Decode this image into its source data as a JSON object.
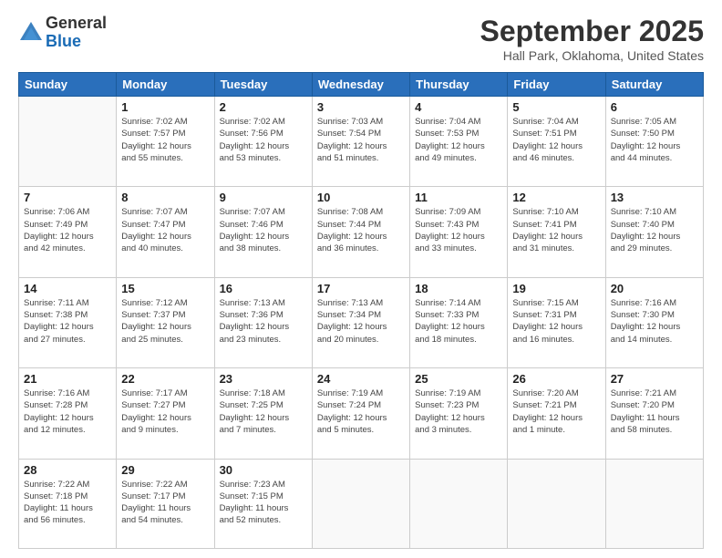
{
  "header": {
    "logo": {
      "general": "General",
      "blue": "Blue"
    },
    "title": "September 2025",
    "location": "Hall Park, Oklahoma, United States"
  },
  "weekdays": [
    "Sunday",
    "Monday",
    "Tuesday",
    "Wednesday",
    "Thursday",
    "Friday",
    "Saturday"
  ],
  "weeks": [
    [
      {
        "day": "",
        "info": ""
      },
      {
        "day": "1",
        "info": "Sunrise: 7:02 AM\nSunset: 7:57 PM\nDaylight: 12 hours\nand 55 minutes."
      },
      {
        "day": "2",
        "info": "Sunrise: 7:02 AM\nSunset: 7:56 PM\nDaylight: 12 hours\nand 53 minutes."
      },
      {
        "day": "3",
        "info": "Sunrise: 7:03 AM\nSunset: 7:54 PM\nDaylight: 12 hours\nand 51 minutes."
      },
      {
        "day": "4",
        "info": "Sunrise: 7:04 AM\nSunset: 7:53 PM\nDaylight: 12 hours\nand 49 minutes."
      },
      {
        "day": "5",
        "info": "Sunrise: 7:04 AM\nSunset: 7:51 PM\nDaylight: 12 hours\nand 46 minutes."
      },
      {
        "day": "6",
        "info": "Sunrise: 7:05 AM\nSunset: 7:50 PM\nDaylight: 12 hours\nand 44 minutes."
      }
    ],
    [
      {
        "day": "7",
        "info": "Sunrise: 7:06 AM\nSunset: 7:49 PM\nDaylight: 12 hours\nand 42 minutes."
      },
      {
        "day": "8",
        "info": "Sunrise: 7:07 AM\nSunset: 7:47 PM\nDaylight: 12 hours\nand 40 minutes."
      },
      {
        "day": "9",
        "info": "Sunrise: 7:07 AM\nSunset: 7:46 PM\nDaylight: 12 hours\nand 38 minutes."
      },
      {
        "day": "10",
        "info": "Sunrise: 7:08 AM\nSunset: 7:44 PM\nDaylight: 12 hours\nand 36 minutes."
      },
      {
        "day": "11",
        "info": "Sunrise: 7:09 AM\nSunset: 7:43 PM\nDaylight: 12 hours\nand 33 minutes."
      },
      {
        "day": "12",
        "info": "Sunrise: 7:10 AM\nSunset: 7:41 PM\nDaylight: 12 hours\nand 31 minutes."
      },
      {
        "day": "13",
        "info": "Sunrise: 7:10 AM\nSunset: 7:40 PM\nDaylight: 12 hours\nand 29 minutes."
      }
    ],
    [
      {
        "day": "14",
        "info": "Sunrise: 7:11 AM\nSunset: 7:38 PM\nDaylight: 12 hours\nand 27 minutes."
      },
      {
        "day": "15",
        "info": "Sunrise: 7:12 AM\nSunset: 7:37 PM\nDaylight: 12 hours\nand 25 minutes."
      },
      {
        "day": "16",
        "info": "Sunrise: 7:13 AM\nSunset: 7:36 PM\nDaylight: 12 hours\nand 23 minutes."
      },
      {
        "day": "17",
        "info": "Sunrise: 7:13 AM\nSunset: 7:34 PM\nDaylight: 12 hours\nand 20 minutes."
      },
      {
        "day": "18",
        "info": "Sunrise: 7:14 AM\nSunset: 7:33 PM\nDaylight: 12 hours\nand 18 minutes."
      },
      {
        "day": "19",
        "info": "Sunrise: 7:15 AM\nSunset: 7:31 PM\nDaylight: 12 hours\nand 16 minutes."
      },
      {
        "day": "20",
        "info": "Sunrise: 7:16 AM\nSunset: 7:30 PM\nDaylight: 12 hours\nand 14 minutes."
      }
    ],
    [
      {
        "day": "21",
        "info": "Sunrise: 7:16 AM\nSunset: 7:28 PM\nDaylight: 12 hours\nand 12 minutes."
      },
      {
        "day": "22",
        "info": "Sunrise: 7:17 AM\nSunset: 7:27 PM\nDaylight: 12 hours\nand 9 minutes."
      },
      {
        "day": "23",
        "info": "Sunrise: 7:18 AM\nSunset: 7:25 PM\nDaylight: 12 hours\nand 7 minutes."
      },
      {
        "day": "24",
        "info": "Sunrise: 7:19 AM\nSunset: 7:24 PM\nDaylight: 12 hours\nand 5 minutes."
      },
      {
        "day": "25",
        "info": "Sunrise: 7:19 AM\nSunset: 7:23 PM\nDaylight: 12 hours\nand 3 minutes."
      },
      {
        "day": "26",
        "info": "Sunrise: 7:20 AM\nSunset: 7:21 PM\nDaylight: 12 hours\nand 1 minute."
      },
      {
        "day": "27",
        "info": "Sunrise: 7:21 AM\nSunset: 7:20 PM\nDaylight: 11 hours\nand 58 minutes."
      }
    ],
    [
      {
        "day": "28",
        "info": "Sunrise: 7:22 AM\nSunset: 7:18 PM\nDaylight: 11 hours\nand 56 minutes."
      },
      {
        "day": "29",
        "info": "Sunrise: 7:22 AM\nSunset: 7:17 PM\nDaylight: 11 hours\nand 54 minutes."
      },
      {
        "day": "30",
        "info": "Sunrise: 7:23 AM\nSunset: 7:15 PM\nDaylight: 11 hours\nand 52 minutes."
      },
      {
        "day": "",
        "info": ""
      },
      {
        "day": "",
        "info": ""
      },
      {
        "day": "",
        "info": ""
      },
      {
        "day": "",
        "info": ""
      }
    ]
  ]
}
